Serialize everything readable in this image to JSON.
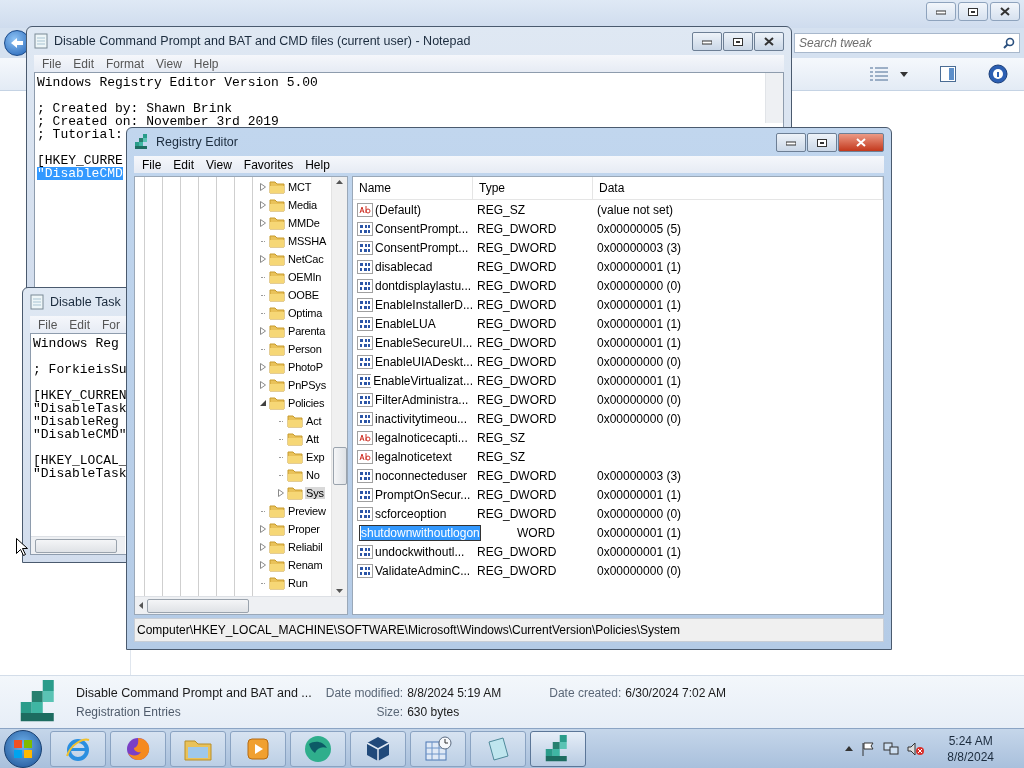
{
  "explorer": {
    "search": {
      "placeholder": "Search tweak"
    },
    "details": {
      "name": "Disable Command Prompt and BAT and ...",
      "type": "Registration Entries",
      "fields": [
        {
          "label": "Date modified:",
          "value": "8/8/2024 5:19 AM"
        },
        {
          "label": "Size:",
          "value": "630 bytes"
        },
        {
          "label": "Date created:",
          "value": "6/30/2024 7:02 AM"
        }
      ]
    }
  },
  "notepad_back": {
    "title": "Disable Task",
    "menu": [
      "File",
      "Edit",
      "For"
    ],
    "blocks": [
      [
        {
          "text": "Windows Reg",
          "selected": false
        }
      ],
      [
        {
          "text": "; ForkieisSu",
          "selected": false
        }
      ],
      [
        {
          "text": "[HKEY_CURREN",
          "selected": false
        },
        {
          "text": "\"DisableTask",
          "selected": false
        },
        {
          "text": "\"DisableReg",
          "selected": false
        },
        {
          "text": "\"DisableCMD\"",
          "selected": false
        }
      ],
      [
        {
          "text": "[HKEY_LOCAL_",
          "selected": false
        },
        {
          "text": "\"DisableTask",
          "selected": false
        }
      ]
    ]
  },
  "notepad_front": {
    "title": "Disable Command Prompt and BAT and CMD files (current user) - Notepad",
    "menu": [
      "File",
      "Edit",
      "Format",
      "View",
      "Help"
    ],
    "blocks": [
      [
        {
          "text": "Windows Registry Editor Version 5.00",
          "selected": false
        }
      ],
      [
        {
          "text": "; Created by: Shawn Brink",
          "selected": false
        },
        {
          "text": "; Created on: November 3rd 2019",
          "selected": false
        },
        {
          "text": "; Tutorial:",
          "selected": false
        }
      ],
      [
        {
          "text": "[HKEY_CURRE",
          "selected": false
        },
        {
          "text": "\"DisableCMD",
          "selected": true
        }
      ]
    ]
  },
  "regedit": {
    "title": "Registry Editor",
    "menu": [
      "File",
      "Edit",
      "View",
      "Favorites",
      "Help"
    ],
    "tree": [
      {
        "label": "MCT",
        "expanded": false,
        "selected": false
      },
      {
        "label": "Media",
        "expanded": false,
        "selected": false
      },
      {
        "label": "MMDe",
        "expanded": false,
        "selected": false
      },
      {
        "label": "MSSHA",
        "selected": false
      },
      {
        "label": "NetCac",
        "expanded": false,
        "selected": false
      },
      {
        "label": "OEMIn",
        "selected": false
      },
      {
        "label": "OOBE",
        "selected": false
      },
      {
        "label": "Optima",
        "selected": false
      },
      {
        "label": "Parenta",
        "expanded": false,
        "selected": false
      },
      {
        "label": "Person",
        "selected": false
      },
      {
        "label": "PhotoP",
        "expanded": false,
        "selected": false
      },
      {
        "label": "PnPSys",
        "expanded": false,
        "selected": false
      },
      {
        "label": "Policies",
        "expanded": true,
        "selected": false,
        "children": [
          {
            "label": "Act",
            "selected": false
          },
          {
            "label": "Att",
            "selected": false
          },
          {
            "label": "Exp",
            "selected": false
          },
          {
            "label": "No",
            "selected": false
          },
          {
            "label": "Sys",
            "expanded": false,
            "selected": true
          }
        ]
      },
      {
        "label": "Preview",
        "selected": false
      },
      {
        "label": "Proper",
        "expanded": false,
        "selected": false
      },
      {
        "label": "Reliabil",
        "expanded": false,
        "selected": false
      },
      {
        "label": "Renam",
        "expanded": false,
        "selected": false
      },
      {
        "label": "Run",
        "selected": false
      }
    ],
    "columns": [
      "Name",
      "Type",
      "Data"
    ],
    "values": [
      {
        "kind": "string",
        "name": "(Default)",
        "type": "REG_SZ",
        "data": "(value not set)",
        "editing": false
      },
      {
        "kind": "dword",
        "name": "ConsentPrompt...",
        "type": "REG_DWORD",
        "data": "0x00000005 (5)",
        "editing": false
      },
      {
        "kind": "dword",
        "name": "ConsentPrompt...",
        "type": "REG_DWORD",
        "data": "0x00000003 (3)",
        "editing": false
      },
      {
        "kind": "dword",
        "name": "disablecad",
        "type": "REG_DWORD",
        "data": "0x00000001 (1)",
        "editing": false
      },
      {
        "kind": "dword",
        "name": "dontdisplaylastu...",
        "type": "REG_DWORD",
        "data": "0x00000000 (0)",
        "editing": false
      },
      {
        "kind": "dword",
        "name": "EnableInstallerD...",
        "type": "REG_DWORD",
        "data": "0x00000001 (1)",
        "editing": false
      },
      {
        "kind": "dword",
        "name": "EnableLUA",
        "type": "REG_DWORD",
        "data": "0x00000001 (1)",
        "editing": false
      },
      {
        "kind": "dword",
        "name": "EnableSecureUI...",
        "type": "REG_DWORD",
        "data": "0x00000001 (1)",
        "editing": false
      },
      {
        "kind": "dword",
        "name": "EnableUIADeskt...",
        "type": "REG_DWORD",
        "data": "0x00000000 (0)",
        "editing": false
      },
      {
        "kind": "dword",
        "name": "EnableVirtualizat...",
        "type": "REG_DWORD",
        "data": "0x00000001 (1)",
        "editing": false
      },
      {
        "kind": "dword",
        "name": "FilterAdministra...",
        "type": "REG_DWORD",
        "data": "0x00000000 (0)",
        "editing": false
      },
      {
        "kind": "dword",
        "name": "inactivitytimeou...",
        "type": "REG_DWORD",
        "data": "0x00000000 (0)",
        "editing": false
      },
      {
        "kind": "string",
        "name": "legalnoticecapti...",
        "type": "REG_SZ",
        "editing": false
      },
      {
        "kind": "string",
        "name": "legalnoticetext",
        "type": "REG_SZ",
        "editing": false
      },
      {
        "kind": "dword",
        "name": "noconnecteduser",
        "type": "REG_DWORD",
        "data": "0x00000003 (3)",
        "editing": false
      },
      {
        "kind": "dword",
        "name": "PromptOnSecur...",
        "type": "REG_DWORD",
        "data": "0x00000001 (1)",
        "editing": false
      },
      {
        "kind": "dword",
        "name": "scforceoption",
        "type": "REG_DWORD",
        "data": "0x00000000 (0)",
        "editing": false
      },
      {
        "kind": "dword",
        "name": "shutdownwithoutlogon",
        "type": "WORD",
        "data": "0x00000001 (1)",
        "editing": true
      },
      {
        "kind": "dword",
        "name": "undockwithoutl...",
        "type": "REG_DWORD",
        "data": "0x00000001 (1)",
        "editing": false
      },
      {
        "kind": "dword",
        "name": "ValidateAdminC...",
        "type": "REG_DWORD",
        "data": "0x00000000 (0)",
        "editing": false
      }
    ],
    "status_bar": "Computer\\HKEY_LOCAL_MACHINE\\SOFTWARE\\Microsoft\\Windows\\CurrentVersion\\Policies\\System"
  },
  "taskbar": {
    "apps": [
      {
        "kind": "browser-e",
        "active": false
      },
      {
        "kind": "fox",
        "active": false
      },
      {
        "kind": "folder",
        "active": false
      },
      {
        "kind": "player",
        "active": false
      },
      {
        "kind": "globe",
        "active": false
      },
      {
        "kind": "cube",
        "active": false
      },
      {
        "kind": "calendar",
        "active": false
      },
      {
        "kind": "notepad",
        "active": false
      },
      {
        "kind": "registry",
        "active": true
      }
    ],
    "time": "5:24 AM",
    "date": "8/8/2024"
  }
}
